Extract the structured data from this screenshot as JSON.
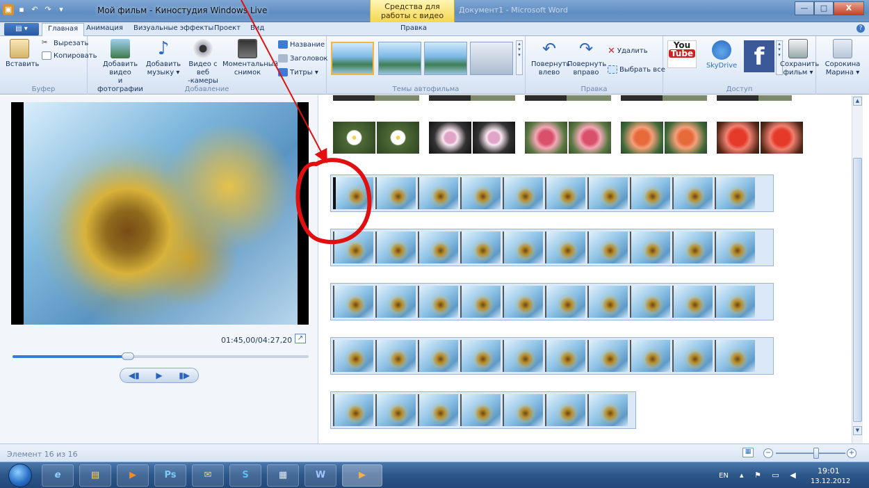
{
  "window": {
    "title": "Мой фильм - Киностудия Windows Live",
    "context_tab": "Средства для работы с видео",
    "ghost_title": "Документ1 - Microsoft Word",
    "buttons": {
      "minimize": "—",
      "maximize": "□",
      "close": "X"
    }
  },
  "tabs": [
    "Главная",
    "Анимация",
    "Визуальные эффекты",
    "Проект",
    "Вид",
    "Правка"
  ],
  "app_menu": "▤ ▾",
  "ribbon": {
    "clipboard": {
      "label": "Буфер",
      "paste": "Вставить",
      "cut": "Вырезать",
      "copy": "Копировать"
    },
    "add": {
      "label": "Добавление",
      "add_video_1": "Добавить видео",
      "add_video_2": "и фотографии",
      "add_music_1": "Добавить",
      "add_music_2": "музыку ▾",
      "webcam_1": "Видео с веб",
      "webcam_2": "-камеры",
      "snapshot_1": "Моментальный",
      "snapshot_2": "снимок",
      "caption": "Название",
      "title": "Заголовок",
      "credits": "Титры ▾"
    },
    "themes": {
      "label": "Темы автофильма"
    },
    "edit": {
      "label": "Правка",
      "rotate_left_1": "Повернуть",
      "rotate_left_2": "влево",
      "rotate_right_1": "Повернуть",
      "rotate_right_2": "вправо",
      "delete": "Удалить",
      "select_all": "Выбрать все"
    },
    "share": {
      "label": "Доступ",
      "youtube_1": "You",
      "youtube_2": "Tube",
      "skydrive": "SkyDrive",
      "facebook": "f"
    },
    "save_1": "Сохранить",
    "save_2": "фильм ▾",
    "user_1": "Сорокина",
    "user_2": "Марина ▾"
  },
  "preview": {
    "timecode": "01:45,00/04:27,20",
    "progress": 0.39,
    "prev": "◀▮",
    "play": "▶",
    "next": "▮▶"
  },
  "status": {
    "text": "Элемент 16 из 16"
  },
  "tray": {
    "lang": "EN",
    "time": "19:01",
    "date": "13.12.2012"
  },
  "taskbar": {
    "apps": [
      "e",
      "▤",
      "▶",
      "Ps",
      "✉",
      "S",
      "▦",
      "W",
      "▶"
    ]
  },
  "colors": {
    "annotation": "#e01010",
    "accent": "#3a7bd0"
  }
}
